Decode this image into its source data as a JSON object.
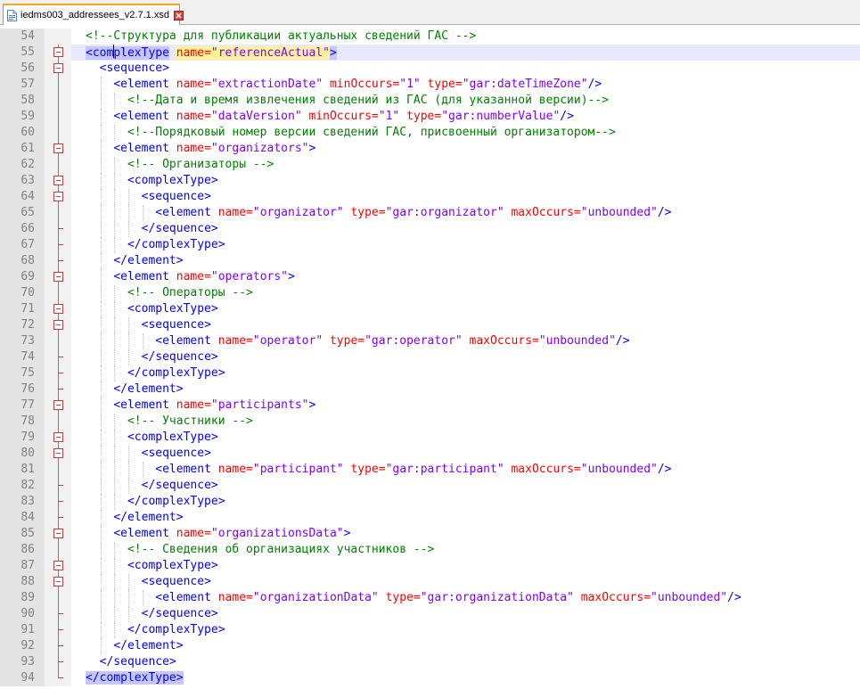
{
  "tab": {
    "title": "iedms003_addressees_v2.7.1.xsd",
    "icon": "xml-file-icon"
  },
  "colors": {
    "tag": "#0000ff",
    "attr": "#ff0000",
    "value": "#8000ff",
    "comment": "#008000",
    "current_line": "#e8e8ff"
  },
  "editor": {
    "current_line": 55,
    "lines": [
      {
        "n": "54",
        "i": 0,
        "f": "v",
        "c": [
          [
            "com",
            "<!--Структура для публикации актуальных сведений ГАС -->"
          ]
        ]
      },
      {
        "n": "55",
        "i": 0,
        "f": "open",
        "c": [
          [
            "hl",
            "<complexType"
          ],
          [
            "sp",
            " "
          ],
          [
            "attr",
            "name="
          ],
          [
            "val",
            "\"referenceActual\""
          ],
          [
            "hl",
            ">"
          ]
        ]
      },
      {
        "n": "56",
        "i": 1,
        "f": "open",
        "c": [
          [
            "tag",
            "<sequence>"
          ]
        ]
      },
      {
        "n": "57",
        "i": 2,
        "f": "v",
        "c": [
          [
            "tag",
            "<element "
          ],
          [
            "attr",
            "name="
          ],
          [
            "val",
            "\"extractionDate\" "
          ],
          [
            "attr",
            "minOccurs="
          ],
          [
            "val",
            "\"1\" "
          ],
          [
            "attr",
            "type="
          ],
          [
            "val",
            "\"gar:dateTimeZone\""
          ],
          [
            "tag",
            "/>"
          ]
        ]
      },
      {
        "n": "58",
        "i": 3,
        "f": "v",
        "c": [
          [
            "com",
            "<!--Дата и время извлечения сведений из ГАС (для указанной версии)-->"
          ]
        ]
      },
      {
        "n": "59",
        "i": 2,
        "f": "v",
        "c": [
          [
            "tag",
            "<element "
          ],
          [
            "attr",
            "name="
          ],
          [
            "val",
            "\"dataVersion\" "
          ],
          [
            "attr",
            "minOccurs="
          ],
          [
            "val",
            "\"1\" "
          ],
          [
            "attr",
            "type="
          ],
          [
            "val",
            "\"gar:numberValue\""
          ],
          [
            "tag",
            "/>"
          ]
        ]
      },
      {
        "n": "60",
        "i": 3,
        "f": "v",
        "c": [
          [
            "com",
            "<!--Порядковый номер версии сведений ГАС, присвоенный организатором-->"
          ]
        ]
      },
      {
        "n": "61",
        "i": 2,
        "f": "open",
        "c": [
          [
            "tag",
            "<element "
          ],
          [
            "attr",
            "name="
          ],
          [
            "val",
            "\"organizators\""
          ],
          [
            "tag",
            ">"
          ]
        ]
      },
      {
        "n": "62",
        "i": 3,
        "f": "v",
        "c": [
          [
            "com",
            "<!-- Организаторы -->"
          ]
        ]
      },
      {
        "n": "63",
        "i": 3,
        "f": "open",
        "c": [
          [
            "tag",
            "<complexType>"
          ]
        ]
      },
      {
        "n": "64",
        "i": 4,
        "f": "open",
        "c": [
          [
            "tag",
            "<sequence>"
          ]
        ]
      },
      {
        "n": "65",
        "i": 5,
        "f": "v",
        "c": [
          [
            "tag",
            "<element "
          ],
          [
            "attr",
            "name="
          ],
          [
            "val",
            "\"organizator\" "
          ],
          [
            "attr",
            "type="
          ],
          [
            "val",
            "\"gar:organizator\" "
          ],
          [
            "attr",
            "maxOccurs="
          ],
          [
            "val",
            "\"unbounded\""
          ],
          [
            "tag",
            "/>"
          ]
        ]
      },
      {
        "n": "66",
        "i": 4,
        "f": "end",
        "c": [
          [
            "tag",
            "</sequence>"
          ]
        ]
      },
      {
        "n": "67",
        "i": 3,
        "f": "end",
        "c": [
          [
            "tag",
            "</complexType>"
          ]
        ]
      },
      {
        "n": "68",
        "i": 2,
        "f": "end",
        "c": [
          [
            "tag",
            "</element>"
          ]
        ]
      },
      {
        "n": "69",
        "i": 2,
        "f": "open",
        "c": [
          [
            "tag",
            "<element "
          ],
          [
            "attr",
            "name="
          ],
          [
            "val",
            "\"operators\""
          ],
          [
            "tag",
            ">"
          ]
        ]
      },
      {
        "n": "70",
        "i": 3,
        "f": "v",
        "c": [
          [
            "com",
            "<!-- Операторы -->"
          ]
        ]
      },
      {
        "n": "71",
        "i": 3,
        "f": "open",
        "c": [
          [
            "tag",
            "<complexType>"
          ]
        ]
      },
      {
        "n": "72",
        "i": 4,
        "f": "open",
        "c": [
          [
            "tag",
            "<sequence>"
          ]
        ]
      },
      {
        "n": "73",
        "i": 5,
        "f": "v",
        "c": [
          [
            "tag",
            "<element "
          ],
          [
            "attr",
            "name="
          ],
          [
            "val",
            "\"operator\" "
          ],
          [
            "attr",
            "type="
          ],
          [
            "val",
            "\"gar:operator\" "
          ],
          [
            "attr",
            "maxOccurs="
          ],
          [
            "val",
            "\"unbounded\""
          ],
          [
            "tag",
            "/>"
          ]
        ]
      },
      {
        "n": "74",
        "i": 4,
        "f": "end",
        "c": [
          [
            "tag",
            "</sequence>"
          ]
        ]
      },
      {
        "n": "75",
        "i": 3,
        "f": "end",
        "c": [
          [
            "tag",
            "</complexType>"
          ]
        ]
      },
      {
        "n": "76",
        "i": 2,
        "f": "end",
        "c": [
          [
            "tag",
            "</element>"
          ]
        ]
      },
      {
        "n": "77",
        "i": 2,
        "f": "open",
        "c": [
          [
            "tag",
            "<element "
          ],
          [
            "attr",
            "name="
          ],
          [
            "val",
            "\"participants\""
          ],
          [
            "tag",
            ">"
          ]
        ]
      },
      {
        "n": "78",
        "i": 3,
        "f": "v",
        "c": [
          [
            "com",
            "<!-- Участники -->"
          ]
        ]
      },
      {
        "n": "79",
        "i": 3,
        "f": "open",
        "c": [
          [
            "tag",
            "<complexType>"
          ]
        ]
      },
      {
        "n": "80",
        "i": 4,
        "f": "open",
        "c": [
          [
            "tag",
            "<sequence>"
          ]
        ]
      },
      {
        "n": "81",
        "i": 5,
        "f": "v",
        "c": [
          [
            "tag",
            "<element "
          ],
          [
            "attr",
            "name="
          ],
          [
            "val",
            "\"participant\" "
          ],
          [
            "attr",
            "type="
          ],
          [
            "val",
            "\"gar:participant\" "
          ],
          [
            "attr",
            "maxOccurs="
          ],
          [
            "val",
            "\"unbounded\""
          ],
          [
            "tag",
            "/>"
          ]
        ]
      },
      {
        "n": "82",
        "i": 4,
        "f": "end",
        "c": [
          [
            "tag",
            "</sequence>"
          ]
        ]
      },
      {
        "n": "83",
        "i": 3,
        "f": "end",
        "c": [
          [
            "tag",
            "</complexType>"
          ]
        ]
      },
      {
        "n": "84",
        "i": 2,
        "f": "end",
        "c": [
          [
            "tag",
            "</element>"
          ]
        ]
      },
      {
        "n": "85",
        "i": 2,
        "f": "open",
        "c": [
          [
            "tag",
            "<element "
          ],
          [
            "attr",
            "name="
          ],
          [
            "val",
            "\"organizationsData\""
          ],
          [
            "tag",
            ">"
          ]
        ]
      },
      {
        "n": "86",
        "i": 3,
        "f": "v",
        "c": [
          [
            "com",
            "<!-- Сведения об организациях участников -->"
          ]
        ]
      },
      {
        "n": "87",
        "i": 3,
        "f": "open",
        "c": [
          [
            "tag",
            "<complexType>"
          ]
        ]
      },
      {
        "n": "88",
        "i": 4,
        "f": "open",
        "c": [
          [
            "tag",
            "<sequence>"
          ]
        ]
      },
      {
        "n": "89",
        "i": 5,
        "f": "v",
        "c": [
          [
            "tag",
            "<element "
          ],
          [
            "attr",
            "name="
          ],
          [
            "val",
            "\"organizationData\" "
          ],
          [
            "attr",
            "type="
          ],
          [
            "val",
            "\"gar:organizationData\" "
          ],
          [
            "attr",
            "maxOccurs="
          ],
          [
            "val",
            "\"unbounded\""
          ],
          [
            "tag",
            "/>"
          ]
        ]
      },
      {
        "n": "90",
        "i": 4,
        "f": "end",
        "c": [
          [
            "tag",
            "</sequence>"
          ]
        ]
      },
      {
        "n": "91",
        "i": 3,
        "f": "end",
        "c": [
          [
            "tag",
            "</complexType>"
          ]
        ]
      },
      {
        "n": "92",
        "i": 2,
        "f": "end",
        "c": [
          [
            "tag",
            "</element>"
          ]
        ]
      },
      {
        "n": "93",
        "i": 1,
        "f": "end",
        "c": [
          [
            "tag",
            "</sequence>"
          ]
        ]
      },
      {
        "n": "94",
        "i": 0,
        "f": "end",
        "c": [
          [
            "hl",
            "</complexType>"
          ]
        ]
      }
    ]
  }
}
